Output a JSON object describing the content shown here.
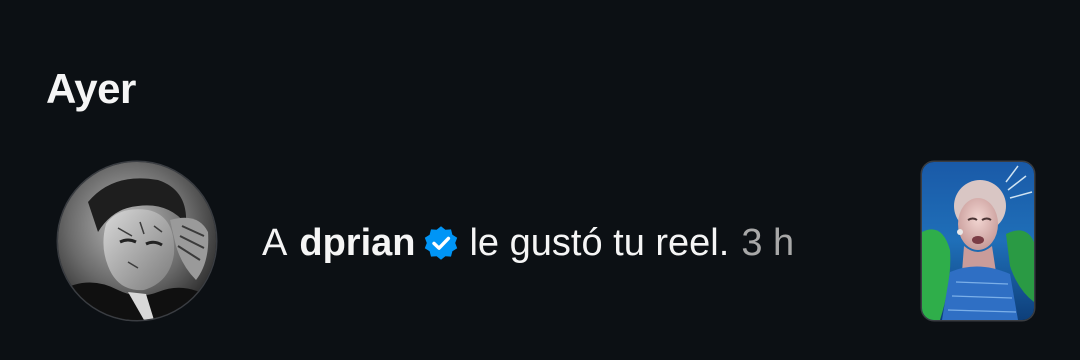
{
  "section": {
    "title": "Ayer"
  },
  "notification": {
    "prefix": "A",
    "username": "dprian",
    "verified": true,
    "action": "le gustó tu reel.",
    "time": "3 h",
    "avatar_icon": "user-avatar-photo",
    "thumbnail_icon": "reel-thumbnail",
    "verified_color": "#0095f6"
  }
}
